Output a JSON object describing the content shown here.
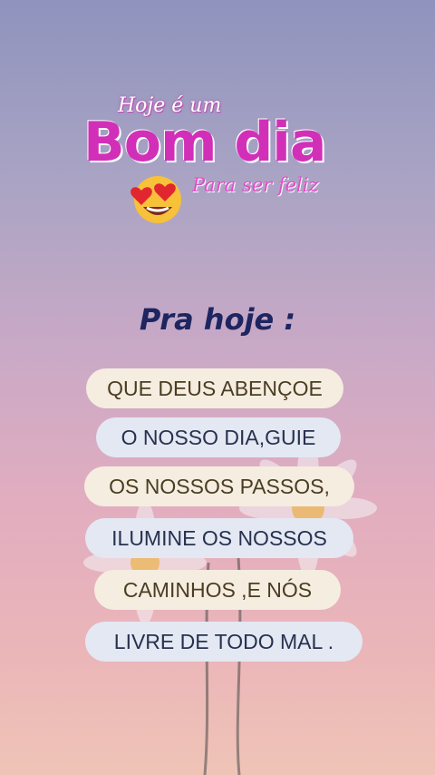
{
  "title": {
    "top_line": "Hoje é um",
    "main": "Bom dia",
    "bottom_line": "Para ser feliz"
  },
  "heading": "Pra hoje :",
  "lines": [
    "QUE DEUS ABENÇOE",
    "O NOSSO DIA,GUIE",
    "OS NOSSOS PASSOS,",
    "ILUMINE OS NOSSOS",
    "CAMINHOS ,E NÓS",
    "LIVRE DE TODO MAL ."
  ],
  "colors": {
    "title_pink": "#d22fb8",
    "heading_navy": "#1e2560",
    "pill_cream": "#f5ede0",
    "pill_blue": "#e3e8f3"
  },
  "icons": [
    "heart-eyes-emoji-icon",
    "daisy-flower-icon"
  ]
}
